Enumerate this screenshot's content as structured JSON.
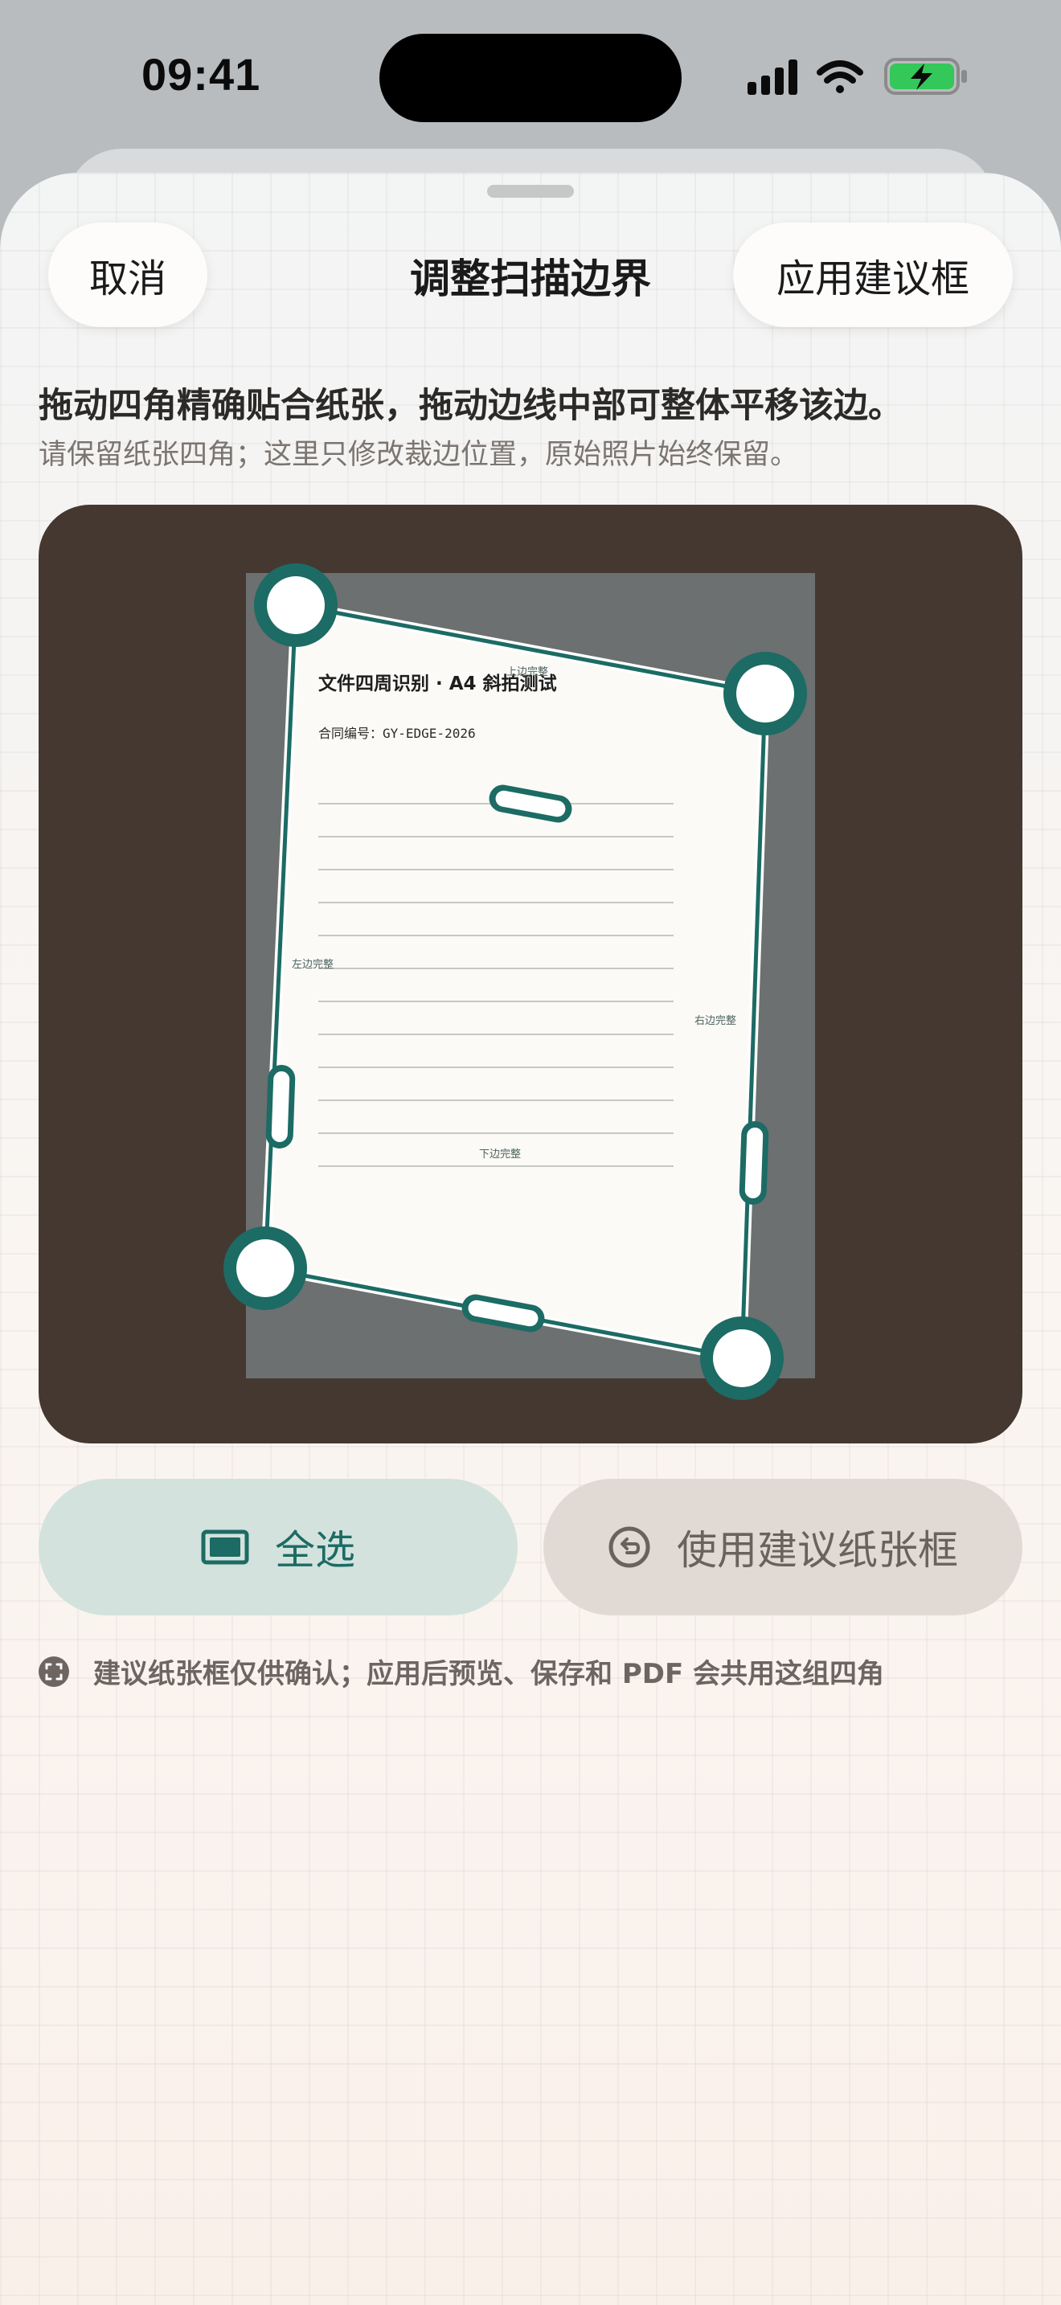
{
  "status_bar": {
    "time": "09:41",
    "icons": [
      "cellular-signal-icon",
      "wifi-icon",
      "battery-charging-icon"
    ]
  },
  "header": {
    "cancel_label": "取消",
    "title": "调整扫描边界",
    "apply_label": "应用建议框"
  },
  "instructions": {
    "main": "拖动四角精确贴合纸张，拖动边线中部可整体平移该边。",
    "sub": "请保留纸张四角；这里只修改裁边位置，原始照片始终保留。"
  },
  "document": {
    "title": "文件四周识别 · A4 斜拍测试",
    "contract": "合同编号：GY-EDGE-2026"
  },
  "edge_labels": {
    "top": "上边完整",
    "left": "左边完整",
    "right": "右边完整",
    "bottom": "下边完整"
  },
  "actions": {
    "select_all_label": "全选",
    "suggest_label": "使用建议纸张框"
  },
  "footer": {
    "note": "建议纸张框仅供确认；应用后预览、保存和 PDF 会共用这组四角"
  },
  "colors": {
    "accent": "#1c6b64",
    "canvas_bg": "#453831",
    "photo_bg": "#6c7070",
    "paper": "#fbfaf7"
  }
}
